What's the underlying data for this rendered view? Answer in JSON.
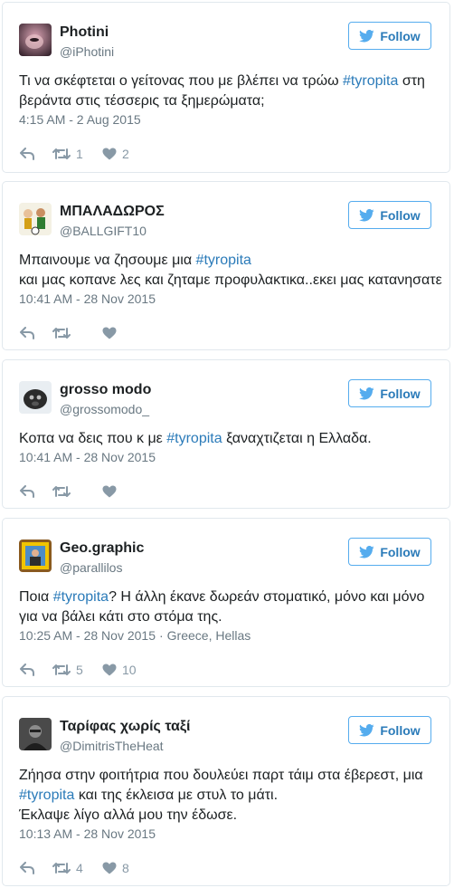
{
  "follow_label": "Follow",
  "tweets": [
    {
      "name": "Photini",
      "handle": "@iPhotini",
      "lines": [
        [
          {
            "t": "Τι να σκέφτεται ο γείτονας που με βλέπει να τρώω "
          },
          {
            "t": "#tyropita",
            "tag": true
          },
          {
            "t": " στη"
          }
        ],
        [
          {
            "t": "βεράντα στις τέσσερις τα ξημερώματα;"
          }
        ]
      ],
      "time": "4:15 AM - 2 Aug 2015",
      "location": "",
      "retweets": "1",
      "likes": "2",
      "avatar": "photini"
    },
    {
      "name": "ΜΠΑΛΑΔΩΡΟΣ",
      "handle": "@BALLGIFT10",
      "lines": [
        [
          {
            "t": "Μπαινουμε να ζησουμε μια "
          },
          {
            "t": "#tyropita",
            "tag": true
          }
        ],
        [
          {
            "t": "και μας κοπανε λες και ζηταμε προφυλακτικα..εκει μας κατανησατε"
          }
        ]
      ],
      "time": "10:41 AM - 28 Nov 2015",
      "location": "",
      "retweets": "",
      "likes": "",
      "avatar": "ballgift"
    },
    {
      "name": "grosso modo",
      "handle": "@grossomodo_",
      "lines": [
        [
          {
            "t": "Κοπα να δεις που κ με "
          },
          {
            "t": "#tyropita",
            "tag": true
          },
          {
            "t": " ξαναχτιζεται η Ελλαδα."
          }
        ]
      ],
      "time": "10:41 AM - 28 Nov 2015",
      "location": "",
      "retweets": "",
      "likes": "",
      "avatar": "grosso"
    },
    {
      "name": "Geo.graphic",
      "handle": "@parallilos",
      "lines": [
        [
          {
            "t": "Ποια "
          },
          {
            "t": "#tyropita",
            "tag": true
          },
          {
            "t": "? Η άλλη έκανε δωρεάν στοματικό, μόνο και μόνο"
          }
        ],
        [
          {
            "t": "για να βάλει κάτι στο στόμα της."
          }
        ]
      ],
      "time": "10:25 AM - 28 Nov 2015",
      "location": "Greece, Hellas",
      "retweets": "5",
      "likes": "10",
      "avatar": "geo"
    },
    {
      "name": "Ταρίφας χωρίς ταξί",
      "handle": "@DimitrisTheHeat",
      "lines": [
        [
          {
            "t": "Ζήησα στην φοιτήτρια που δουλεύει παρτ τάιμ στα έβερεστ, μια"
          }
        ],
        [
          {
            "t": "#tyropita",
            "tag": true
          },
          {
            "t": "  και της έκλεισα με στυλ το μάτι."
          }
        ],
        [
          {
            "t": "Έκλαψε λίγο αλλά μου την έδωσε."
          }
        ]
      ],
      "time": "10:13 AM - 28 Nov 2015",
      "location": "",
      "retweets": "4",
      "likes": "8",
      "avatar": "dimitris"
    }
  ]
}
